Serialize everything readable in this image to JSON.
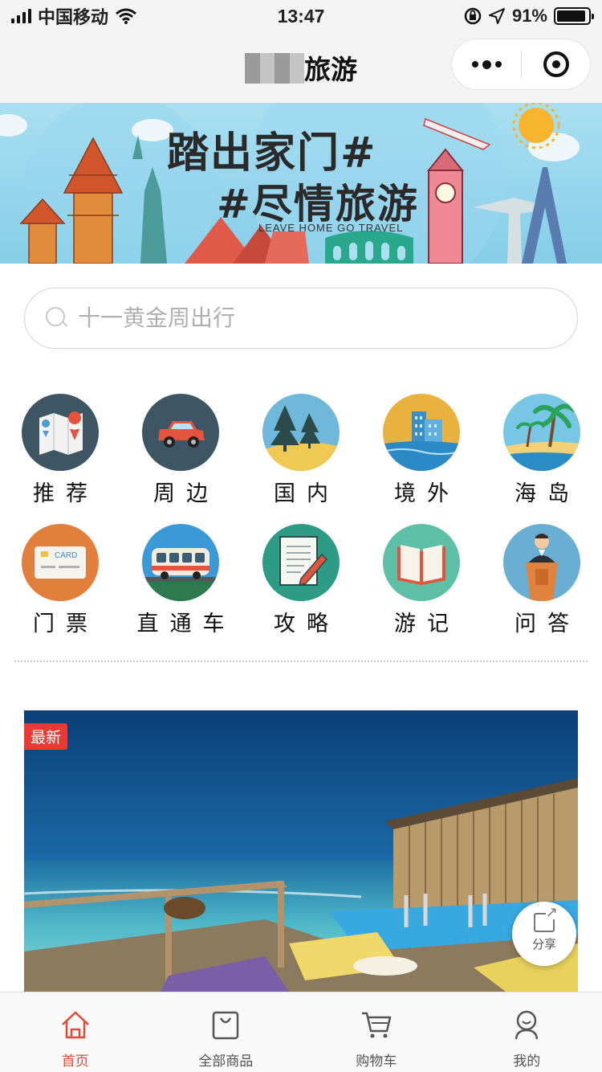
{
  "status_bar": {
    "carrier": "中国移动",
    "time": "13:47",
    "battery": "91%",
    "battery_level": 0.91
  },
  "nav": {
    "title": "旅游"
  },
  "banner": {
    "headline_1": "踏出家门#",
    "headline_2": "#尽情旅游",
    "subline": "LEAVE HOME GO TRAVEL",
    "sign_text": "CARD"
  },
  "search": {
    "placeholder": "十一黄金周出行"
  },
  "categories": [
    {
      "label": "推荐",
      "icon": "map-pin-icon"
    },
    {
      "label": "周边",
      "icon": "car-icon"
    },
    {
      "label": "国内",
      "icon": "pine-trees-icon"
    },
    {
      "label": "境外",
      "icon": "city-hotel-icon"
    },
    {
      "label": "海岛",
      "icon": "palm-island-icon"
    },
    {
      "label": "门票",
      "icon": "ticket-card-icon"
    },
    {
      "label": "直通车",
      "icon": "bus-icon"
    },
    {
      "label": "攻略",
      "icon": "notepad-pen-icon"
    },
    {
      "label": "游记",
      "icon": "open-book-icon"
    },
    {
      "label": "问答",
      "icon": "speaker-podium-icon"
    }
  ],
  "card_text": "CARD",
  "feature": {
    "badge": "最新",
    "share_label": "分享"
  },
  "tabbar": [
    {
      "label": "首页",
      "icon": "home-icon",
      "active": true
    },
    {
      "label": "全部商品",
      "icon": "shopping-bag-icon",
      "active": false
    },
    {
      "label": "购物车",
      "icon": "cart-icon",
      "active": false
    },
    {
      "label": "我的",
      "icon": "profile-icon",
      "active": false
    }
  ],
  "colors": {
    "accent": "#e34a35",
    "badge": "#e93a34",
    "navbar_bg": "#f4f4f4"
  }
}
